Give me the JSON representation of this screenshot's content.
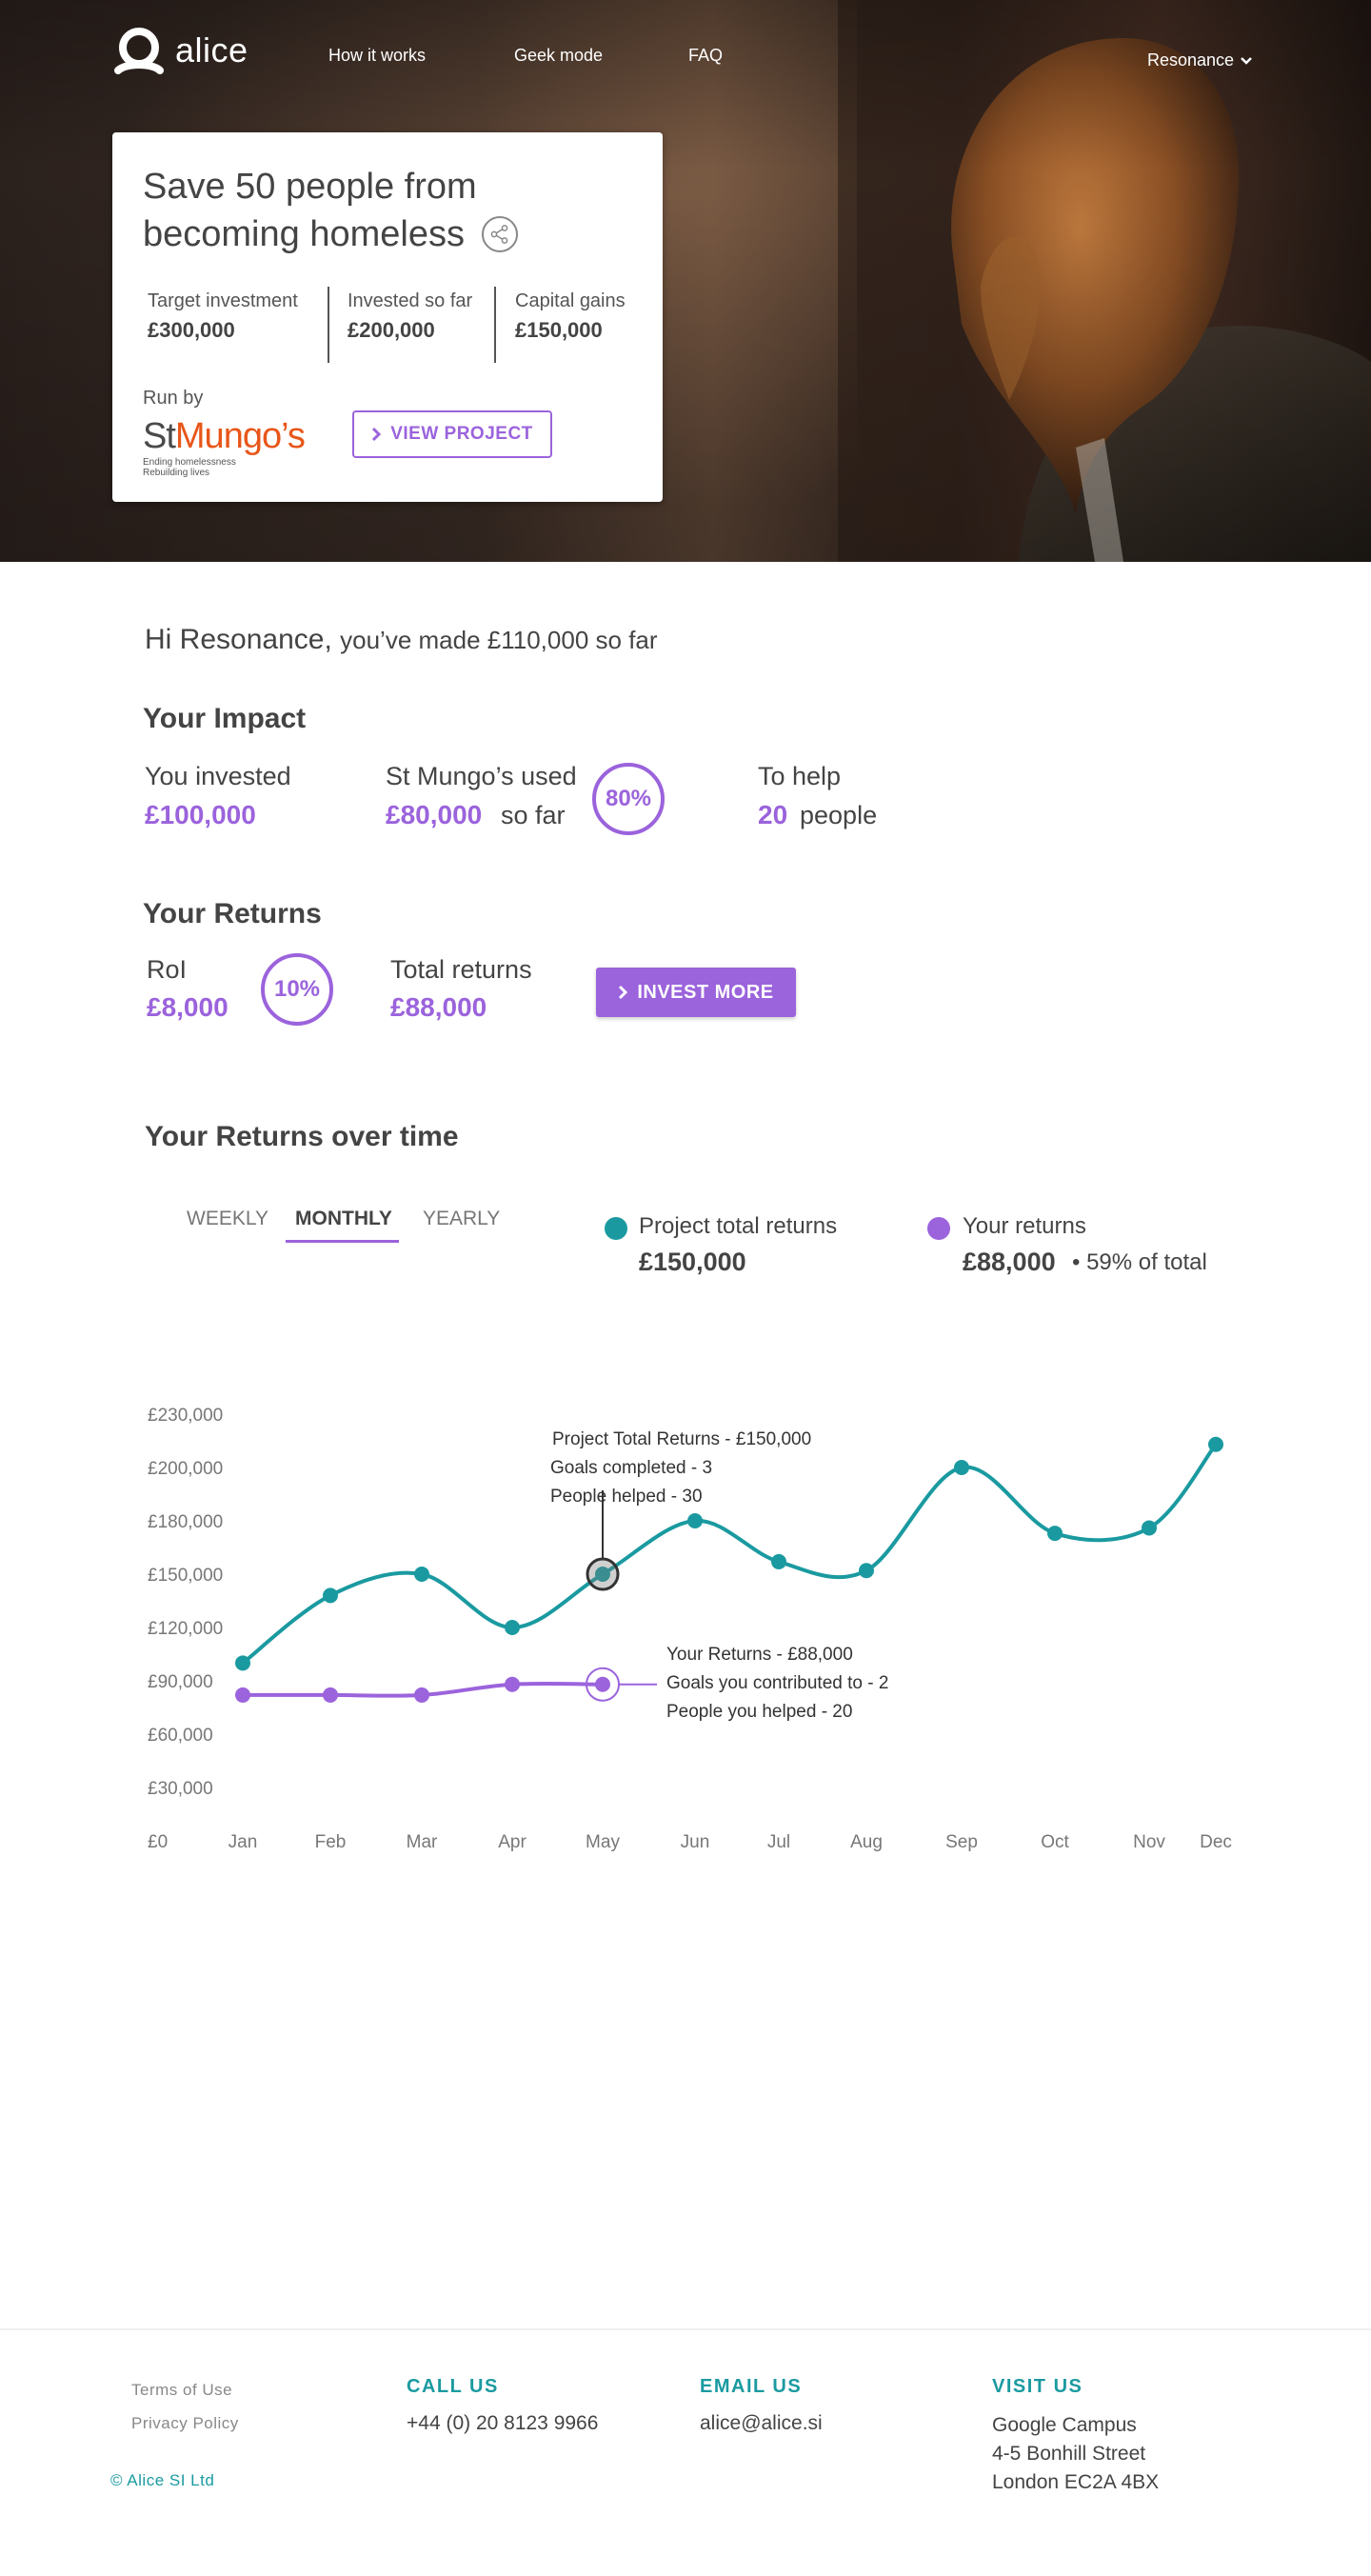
{
  "brand": {
    "name": "alice"
  },
  "nav": {
    "links": [
      "How it works",
      "Geek mode",
      "FAQ"
    ],
    "user": "Resonance"
  },
  "project": {
    "title": "Save 50 people from becoming homeless",
    "stats": [
      {
        "label": "Target investment",
        "value": "£300,000"
      },
      {
        "label": "Invested so far",
        "value": "£200,000"
      },
      {
        "label": "Capital gains",
        "value": "£150,000"
      }
    ],
    "run_by_label": "Run by",
    "org_logo": {
      "st": "St",
      "mungo": "Mungo’s",
      "tag1": "Ending homelessness",
      "tag2": "Rebuilding lives"
    },
    "view_button": "VIEW PROJECT"
  },
  "greeting": {
    "hi": "Hi Resonance,",
    "sub": "you’ve made £110,000 so far"
  },
  "impact": {
    "heading": "Your Impact",
    "invested_label": "You invested",
    "invested_value": "£100,000",
    "used_label": "St Mungo’s used",
    "used_value": "£80,000",
    "used_suffix": "so far",
    "used_percent": "80%",
    "help_label": "To help",
    "help_value": "20",
    "help_suffix": "people"
  },
  "returns": {
    "heading": "Your Returns",
    "roi_label": "RoI",
    "roi_value": "£8,000",
    "roi_percent": "10%",
    "total_label": "Total returns",
    "total_value": "£88,000",
    "invest_button": "INVEST MORE"
  },
  "over_time": {
    "heading": "Your Returns over time",
    "tabs": [
      "WEEKLY",
      "MONTHLY",
      "YEARLY"
    ],
    "active_tab": "MONTHLY",
    "legend": [
      {
        "name": "Project total returns",
        "value": "£150,000",
        "color": "#1a9aa0"
      },
      {
        "name": "Your returns",
        "value": "£88,000",
        "note": "59% of total",
        "color": "#9b63dc"
      }
    ]
  },
  "chart_data": {
    "type": "line",
    "categories": [
      "Jan",
      "Feb",
      "Mar",
      "Apr",
      "May",
      "Jun",
      "Jul",
      "Aug",
      "Sep",
      "Oct",
      "Nov",
      "Dec"
    ],
    "y_ticks": [
      "£230,000",
      "£200,000",
      "£180,000",
      "£150,000",
      "£120,000",
      "£90,000",
      "£60,000",
      "£30,000",
      "£0"
    ],
    "series": [
      {
        "name": "Project total returns",
        "color": "#1a9aa0",
        "values": [
          100000,
          138000,
          150000,
          120000,
          150000,
          180000,
          157000,
          152000,
          200000,
          173000,
          176000,
          213000
        ]
      },
      {
        "name": "Your returns",
        "color": "#9b63dc",
        "values": [
          82000,
          82000,
          82000,
          88000,
          88000
        ]
      }
    ],
    "tooltips": {
      "project": [
        "Project Total Returns - £150,000",
        "Goals completed - 3",
        "People helped - 30"
      ],
      "yours": [
        "Your Returns - £88,000",
        "Goals you contributed to - 2",
        "People you helped - 20"
      ]
    }
  },
  "footer": {
    "terms": "Terms of Use",
    "privacy": "Privacy Policy",
    "copyright": "© Alice SI Ltd",
    "call_heading": "CALL US",
    "phone": "+44 (0) 20 8123 9966",
    "email_heading": "EMAIL US",
    "email": "alice@alice.si",
    "visit_heading": "VISIT US",
    "address": [
      "Google Campus",
      "4-5 Bonhill Street",
      "London EC2A 4BX"
    ]
  }
}
